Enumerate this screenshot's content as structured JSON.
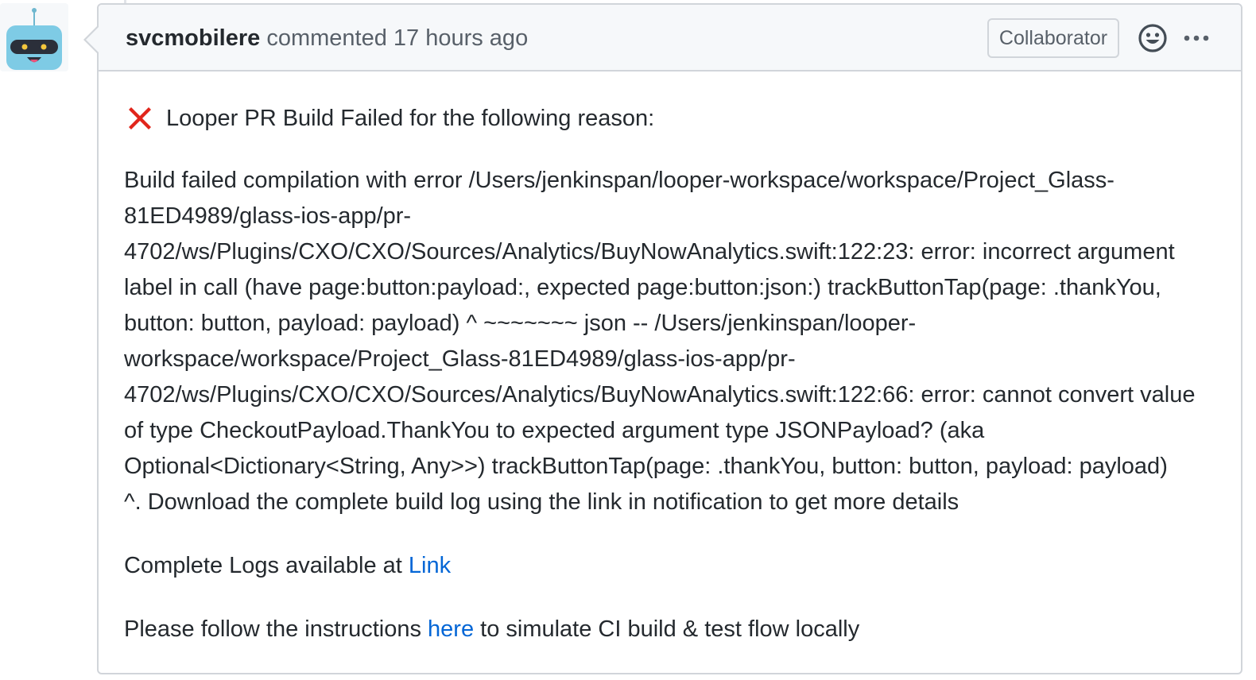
{
  "comment": {
    "author": "svcmobilere",
    "action_text": " commented 17 hours ago",
    "role_badge": "Collaborator",
    "reaction_icon": "smiley-icon",
    "more_icon": "kebab-horizontal-icon",
    "avatar_icon": "robot-icon"
  },
  "body": {
    "status_icon": "x-icon",
    "status_color": "#e1251b",
    "title": "Looper PR Build Failed for the following reason:",
    "error_line_1": "Build failed compilation with error /Users/jenkinspan/looper-workspace/workspace/Project_Glass-",
    "error_line_2": "81ED4989/glass-ios-app/pr-",
    "error_line_3": "4702/ws/Plugins/CXO/CXO/Sources/Analytics/BuyNowAnalytics.swift:122:23: error: incorrect argument",
    "error_line_4": "label in call (have page:button:payload:, expected page:button:json:) trackButtonTap(page: .thankYou,",
    "error_line_5": "button: button, payload: payload) ^ ~~~~~~~ json -- /Users/jenkinspan/looper-",
    "error_line_6": "workspace/workspace/Project_Glass-81ED4989/glass-ios-app/pr-",
    "error_line_7": "4702/ws/Plugins/CXO/CXO/Sources/Analytics/BuyNowAnalytics.swift:122:66: error: cannot convert value",
    "error_line_8": "of type CheckoutPayload.ThankYou to expected argument type JSONPayload? (aka",
    "error_line_9": "Optional<Dictionary<String, Any>>) trackButtonTap(page: .thankYou, button: button, payload: payload)",
    "error_line_10": "^. Download the complete build log using the link in notification to get more details",
    "logs_prefix": "Complete Logs available at ",
    "logs_link": "Link",
    "follow_prefix": "Please follow the instructions ",
    "follow_link": "here",
    "follow_suffix": " to simulate CI build & test flow locally"
  },
  "colors": {
    "link": "#0366d6",
    "header_bg": "#f6f8fa",
    "border": "#d1d5da",
    "avatar_head": "#7ecbe5"
  }
}
